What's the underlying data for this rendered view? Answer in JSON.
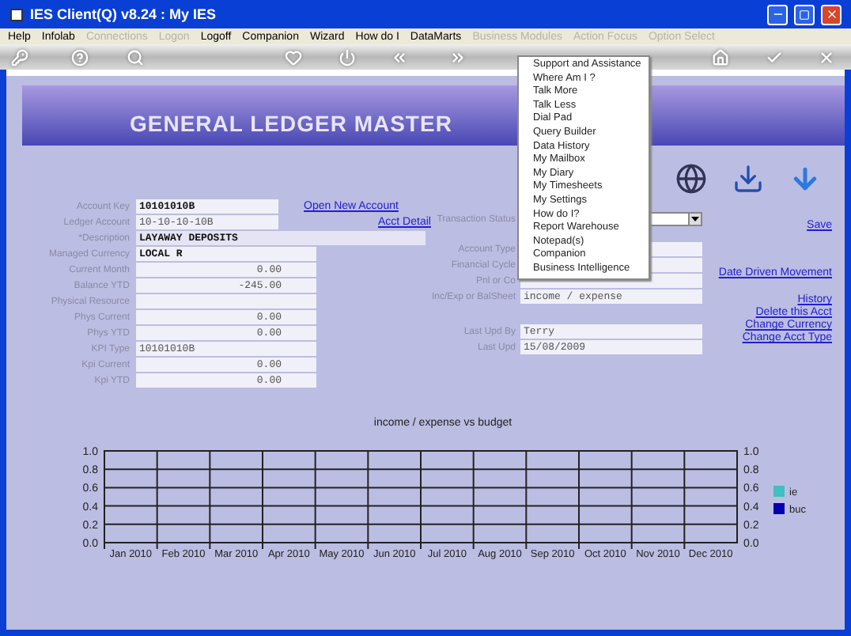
{
  "window": {
    "title": "IES Client(Q) v8.24 : My IES"
  },
  "menu": [
    {
      "label": "Help",
      "disabled": false
    },
    {
      "label": "Infolab",
      "disabled": false
    },
    {
      "label": "Connections",
      "disabled": true
    },
    {
      "label": "Logon",
      "disabled": true
    },
    {
      "label": "Logoff",
      "disabled": false
    },
    {
      "label": "Companion",
      "disabled": false
    },
    {
      "label": "Wizard",
      "disabled": false
    },
    {
      "label": "How do I",
      "disabled": false
    },
    {
      "label": "DataMarts",
      "disabled": false
    },
    {
      "label": "Business Modules",
      "disabled": true
    },
    {
      "label": "Action Focus",
      "disabled": true
    },
    {
      "label": "Option Select",
      "disabled": true
    }
  ],
  "header": {
    "title": "GENERAL LEDGER MASTER"
  },
  "account_fields": [
    {
      "label": "Account Key",
      "value": "10101010B"
    },
    {
      "label": "Ledger Account",
      "value": "10-10-10-10B"
    },
    {
      "label": "*Description",
      "value": "LAYAWAY DEPOSITS"
    },
    {
      "label": "Managed Currency",
      "value": "LOCAL R"
    },
    {
      "label": "Current Month",
      "value": "0.00"
    },
    {
      "label": "Balance YTD",
      "value": "-245.00"
    },
    {
      "label": "Physical Resource"
    },
    {
      "label": "Phys Current",
      "value": "0.00"
    },
    {
      "label": "Phys YTD",
      "value": "0.00"
    },
    {
      "label": "KPI Type",
      "value": "10101010B"
    },
    {
      "label": "Kpi Current",
      "value": "0.00"
    },
    {
      "label": "Kpi YTD",
      "value": "0.00"
    }
  ],
  "account_links": [
    "Open New Account",
    "Acct Detail"
  ],
  "status_fields": [
    [
      {
        "label": "Transaction Status",
        "kind": "select"
      }
    ],
    [
      {
        "label": "Account Type",
        "kind": "text"
      },
      {
        "label": "Financial Cycle",
        "kind": "text"
      },
      {
        "label": "Pnl or Co",
        "kind": "text"
      },
      {
        "label": "Inc/Exp or BalSheet",
        "kind": "text",
        "value": "income / expense"
      }
    ],
    [
      {
        "label": "Last Upd By",
        "kind": "text",
        "value": "Terry"
      },
      {
        "label": "Last Upd",
        "kind": "text",
        "value": "15/08/2009"
      }
    ]
  ],
  "action_links": [
    [
      "Save"
    ],
    [
      "Date Driven Movement"
    ],
    [
      "History",
      "Delete this Acct",
      "Change Currency",
      "Change Acct Type"
    ]
  ],
  "popup_menu": [
    "Support and Assistance",
    "Where Am I ?",
    "Talk More",
    "Talk Less",
    "Dial Pad",
    "Query Builder",
    "Data History",
    "My Mailbox",
    "My Diary",
    "My Timesheets",
    "My Settings",
    "How do I?",
    "Report Warehouse",
    "Notepad(s)",
    "Companion",
    "Business Intelligence"
  ],
  "chart": {
    "chart_data": {
      "type": "bar",
      "title": "income / expense vs budget",
      "categories": [
        "Jan 2010",
        "Feb 2010",
        "Mar 2010",
        "Apr 2010",
        "May 2010",
        "Jun 2010",
        "Jul 2010",
        "Aug 2010",
        "Sep 2010",
        "Oct 2010",
        "Nov 2010",
        "Dec 2010"
      ],
      "series": [
        {
          "name": "ie",
          "color": "#40c0c0",
          "values": [
            null,
            null,
            null,
            null,
            null,
            null,
            null,
            null,
            null,
            null,
            null,
            null
          ]
        },
        {
          "name": "buc",
          "color": "#0000b0",
          "values": [
            null,
            null,
            null,
            null,
            null,
            null,
            null,
            null,
            null,
            null,
            null,
            null
          ]
        }
      ],
      "grid": true,
      "ylim": [
        0,
        1
      ],
      "yticks": [
        {
          "value": 0,
          "label": "0.0"
        },
        {
          "value": 0.2,
          "label": "0.2"
        },
        {
          "value": 0.4,
          "label": "0.4"
        },
        {
          "value": 0.6,
          "label": "0.6"
        },
        {
          "value": 0.8,
          "label": "0.8"
        },
        {
          "value": 1,
          "label": "1.0"
        }
      ]
    }
  }
}
